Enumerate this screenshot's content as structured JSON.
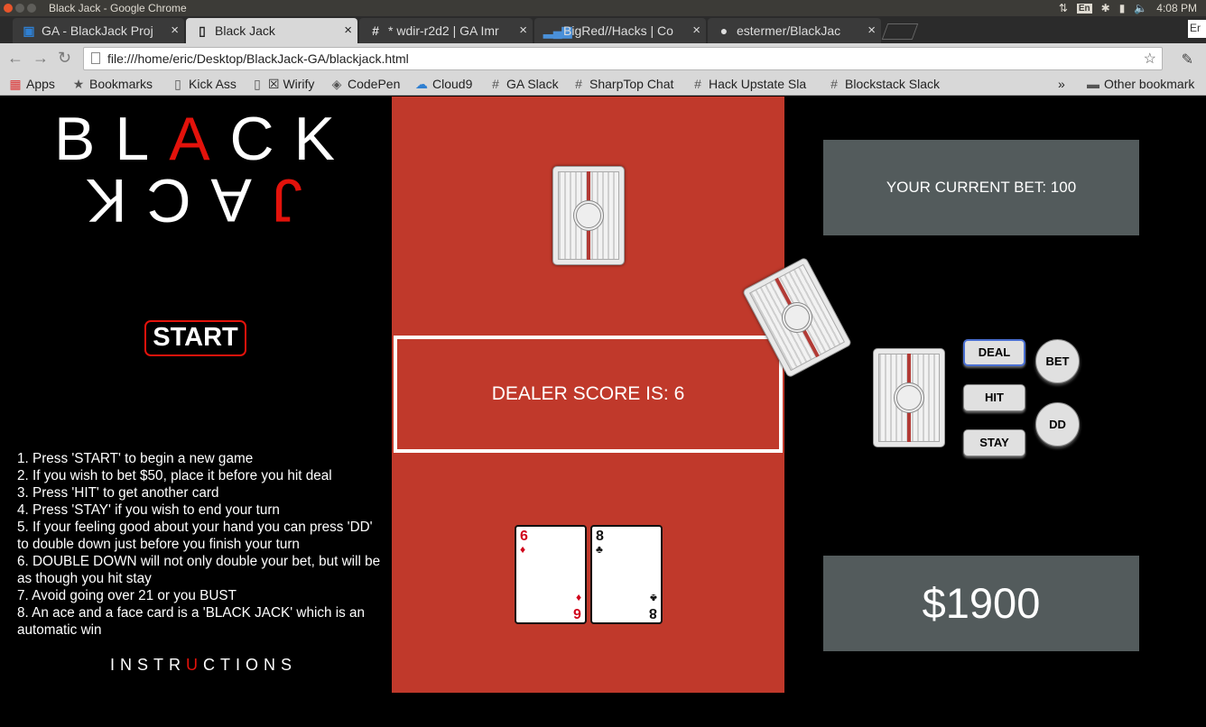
{
  "os": {
    "window_title": "Black Jack - Google Chrome",
    "lang": "En",
    "time": "4:08 PM"
  },
  "tabs": [
    {
      "label": "GA - BlackJack Proj",
      "icon": "trello-icon"
    },
    {
      "label": "Black Jack",
      "icon": "page-icon"
    },
    {
      "label": "* wdir-r2d2 | GA Imr",
      "icon": "slack-icon"
    },
    {
      "label": "BigRed//Hacks | Co",
      "icon": "signal-icon"
    },
    {
      "label": "estermer/BlackJac",
      "icon": "github-icon"
    }
  ],
  "profile_label": "Er",
  "toolbar": {
    "url": "file:///home/eric/Desktop/BlackJack-GA/blackjack.html"
  },
  "bookmarks": {
    "items": [
      "Apps",
      "Bookmarks",
      "Kick Ass",
      "☒ Wirify",
      "CodePen",
      "Cloud9",
      "GA Slack",
      "SharpTop Chat",
      "Hack Upstate Sla",
      "Blockstack Slack"
    ],
    "overflow": "»",
    "other": "Other bookmark"
  },
  "game": {
    "logo": {
      "row1": [
        "B",
        "L",
        "A",
        "C",
        "K"
      ],
      "row2": [
        "J",
        "A",
        "C",
        "K"
      ]
    },
    "start_label": "START",
    "instructions": [
      "1. Press 'START' to begin a new game",
      "2. If you wish to bet $50, place it before you hit deal",
      "3. Press 'HIT' to get another card",
      "4. Press 'STAY' if you wish to end your turn",
      "5. If your feeling good about your hand you can press 'DD' to double down just before you finish your turn",
      "6. DOUBLE DOWN will not only double your bet, but will be as though you hit stay",
      "7. Avoid going over 21 or you BUST",
      "8. An ace and a face card is a 'BLACK JACK' which is an automatic win"
    ],
    "instructions_title": {
      "before": "INSTR",
      "red": "U",
      "after": "CTIONS"
    },
    "dealer_score": "DEALER SCORE IS: 6",
    "player_cards": [
      {
        "rank": "6",
        "suit": "♦",
        "color": "red"
      },
      {
        "rank": "8",
        "suit": "♣",
        "color": "black"
      }
    ],
    "current_bet": "YOUR CURRENT BET: 100",
    "bankroll": "$1900",
    "buttons": {
      "deal": "DEAL",
      "hit": "HIT",
      "stay": "STAY",
      "bet": "BET",
      "dd": "DD"
    },
    "colors": {
      "table": "#c0392b",
      "accent_red": "#e3120b",
      "info_box": "#535b5c"
    }
  }
}
